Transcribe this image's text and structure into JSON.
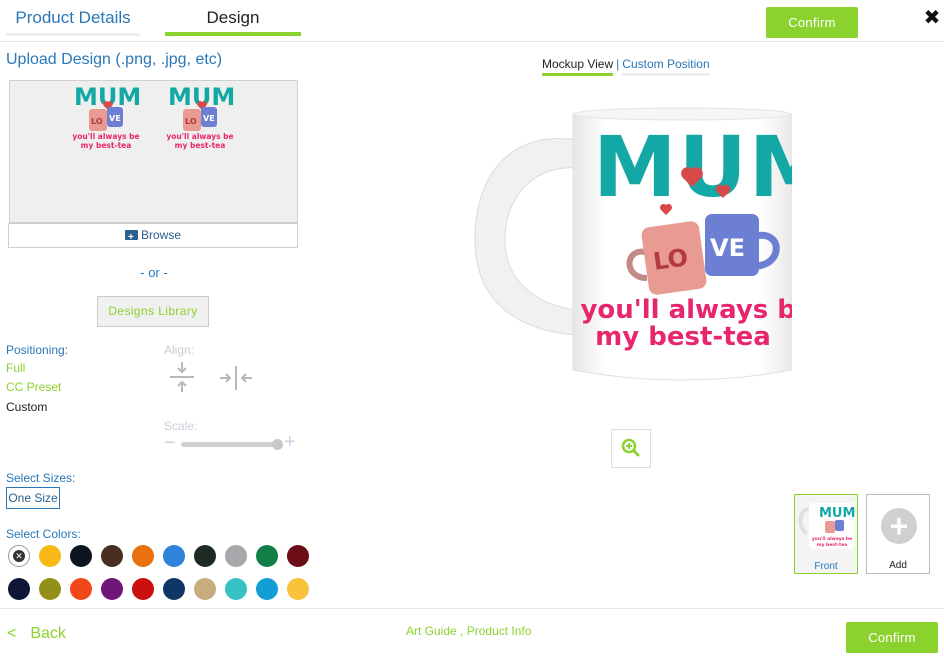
{
  "header": {
    "tabs": [
      {
        "label": "Product Details"
      },
      {
        "label": "Design"
      }
    ],
    "confirm_label": "Confirm",
    "close_glyph": "✖"
  },
  "upload": {
    "title": "Upload Design (.png, .jpg, etc)",
    "browse_label": "Browse",
    "or_text": "- or -",
    "library_label": "Designs Library",
    "design_artwork": {
      "word": "MUM",
      "mug_left_text": "LO",
      "mug_right_text": "VE",
      "line1": "you'll always be",
      "line2": "my best-tea"
    }
  },
  "positioning": {
    "label": "Positioning:",
    "options": [
      {
        "label": "Full",
        "color": "#8cd22e"
      },
      {
        "label": "CC Preset",
        "color": "#8cd22e"
      },
      {
        "label": "Custom",
        "color": "#222222"
      }
    ],
    "align_label": "Align:",
    "scale_label": "Scale:",
    "scale_minus": "−",
    "scale_plus": "+",
    "align_icons": [
      "align-vertical-center-icon",
      "align-horizontal-center-icon"
    ]
  },
  "sizes": {
    "label": "Select Sizes:",
    "options": [
      "One Size"
    ]
  },
  "colors": {
    "label": "Select Colors:",
    "swatches": [
      "none",
      "#f8b818",
      "#0c1520",
      "#4a2e22",
      "#e8700e",
      "#2f84da",
      "#1e2b22",
      "#a8a8ac",
      "#108048",
      "#6c0c14",
      "#0f1638",
      "#929019",
      "#f2471a",
      "#6f1678",
      "#cc1010",
      "#0f3766",
      "#c7ac7e",
      "#36c2c4",
      "#109ed4",
      "#f8c23a"
    ]
  },
  "view": {
    "mockup_label": "Mockup View",
    "separator": "|",
    "custom_label": "Custom Position"
  },
  "mockup": {
    "word": "MUM",
    "mug_left_text": "LO",
    "mug_right_text": "VE",
    "line1": "you'll always be",
    "line2": "my best-tea",
    "zoom_icon": "zoom-in-icon"
  },
  "thumbnails": {
    "front_label": "Front",
    "add_label": "Add",
    "add_glyph": "+"
  },
  "footer": {
    "back_chevron": "<",
    "back_label": "Back",
    "art_guide": "Art Guide",
    "product_info": "Product Info",
    "separator": " , ",
    "confirm_label": "Confirm"
  },
  "theme": {
    "accent": "#8cd22e",
    "link": "#2a77b8",
    "teal": "#13a8a5",
    "pink": "#e8266e",
    "heart": "#d84a4a"
  }
}
